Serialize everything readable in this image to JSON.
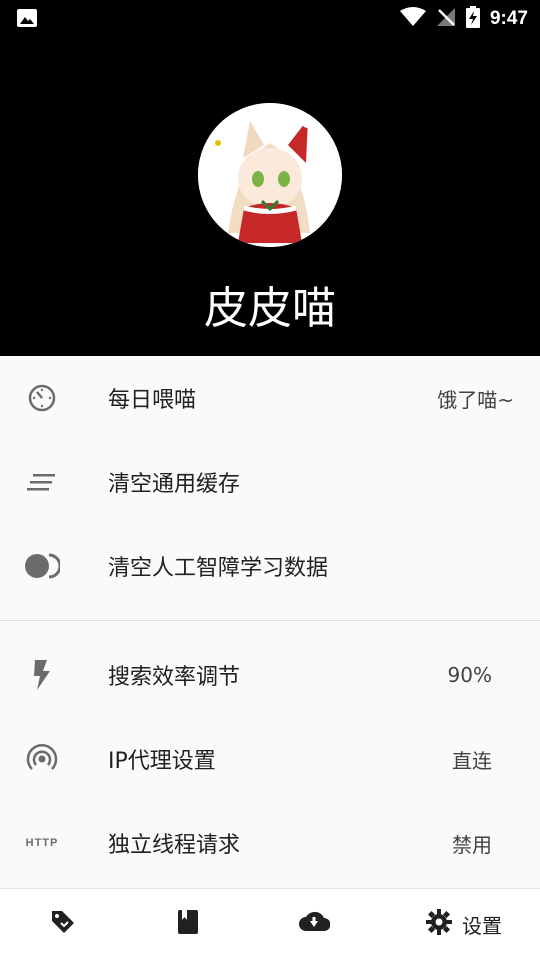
{
  "status_bar": {
    "time": "9:47"
  },
  "profile": {
    "name": "皮皮喵"
  },
  "menu": {
    "group1": [
      {
        "label": "每日喂喵",
        "value": "饿了喵~",
        "icon": "timer-icon"
      },
      {
        "label": "清空通用缓存",
        "value": "",
        "icon": "clear-all-icon"
      },
      {
        "label": "清空人工智障学习数据",
        "value": "",
        "icon": "toggle-icon"
      }
    ],
    "group2": [
      {
        "label": "搜索效率调节",
        "value": "90%",
        "icon": "flash-icon"
      },
      {
        "label": "IP代理设置",
        "value": "直连",
        "icon": "signal-icon"
      },
      {
        "label": "独立线程请求",
        "value": "禁用",
        "icon": "http-icon",
        "icon_text": "HTTP"
      }
    ]
  },
  "bottom_nav": {
    "settings_label": "设置"
  }
}
